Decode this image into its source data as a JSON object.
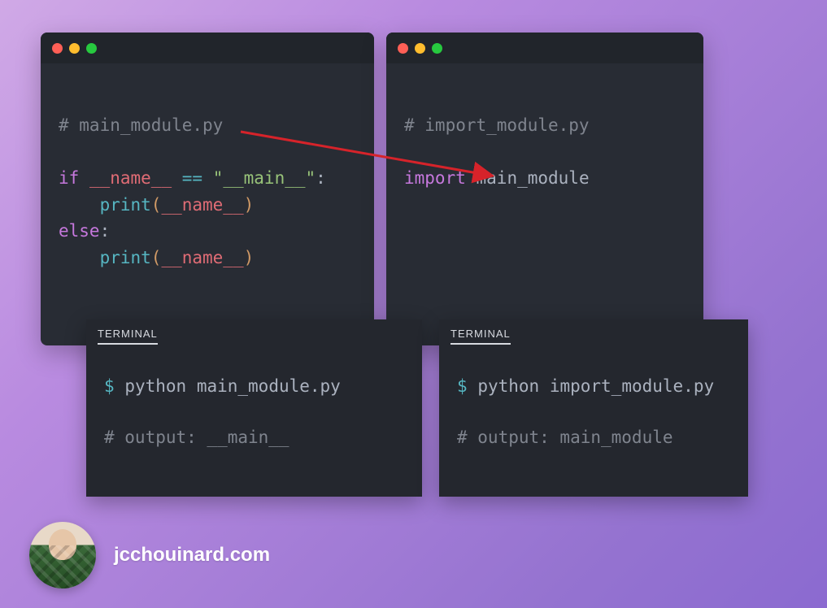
{
  "left_window": {
    "comment": "# main_module.py",
    "if_kw": "if",
    "dunder_name": "__name__",
    "eq": "==",
    "main_str": "\"__main__\"",
    "colon": ":",
    "print_fn": "print",
    "lparen": "(",
    "rparen": ")",
    "else_kw": "else"
  },
  "right_window": {
    "comment": "# import_module.py",
    "import_kw": "import",
    "module": "main_module"
  },
  "terminals": {
    "label": "TERMINAL",
    "prompt": "$",
    "left_cmd": "python main_module.py",
    "left_out": "# output: __main__",
    "right_cmd": "python import_module.py",
    "right_out": "# output: main_module"
  },
  "attribution": {
    "site": "jcchouinard.com"
  },
  "colors": {
    "arrow": "#d6232a"
  }
}
